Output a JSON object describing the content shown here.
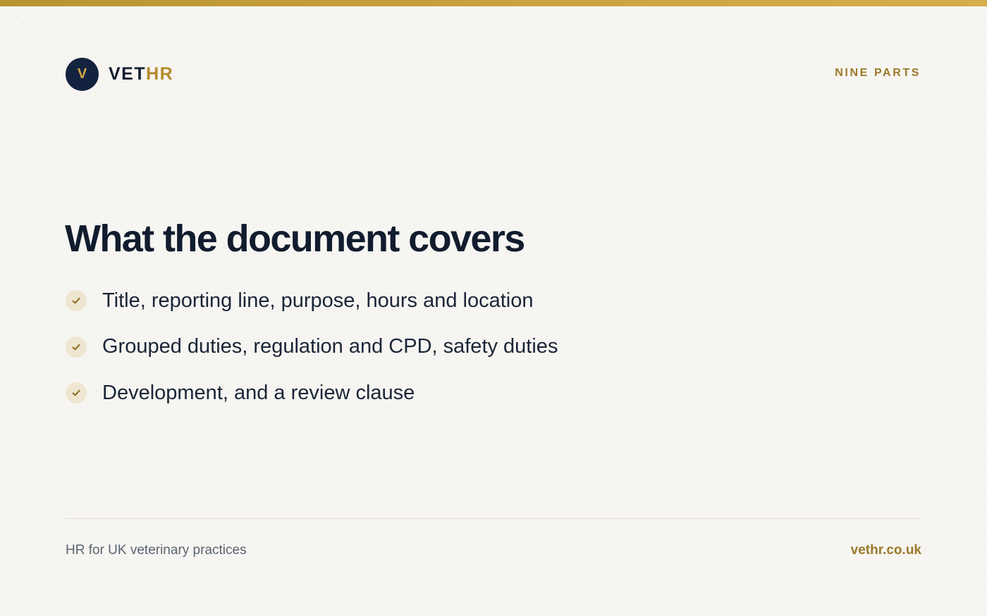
{
  "brand": {
    "badge_letter": "V",
    "name_part1": "VET",
    "name_part2": "HR"
  },
  "section_tag": "NINE PARTS",
  "title": "What the document covers",
  "points": [
    {
      "icon": "check-icon",
      "text": "Title, reporting line, purpose, hours and location"
    },
    {
      "icon": "check-icon",
      "text": "Grouped duties, regulation and CPD, safety duties"
    },
    {
      "icon": "check-icon",
      "text": "Development, and a review clause"
    }
  ],
  "footer": {
    "tagline": "HR for UK veterinary practices",
    "website": "vethr.co.uk"
  },
  "colors": {
    "accent_gold": "#b38b2c",
    "navy": "#13233f",
    "background": "#f6f5f1"
  }
}
